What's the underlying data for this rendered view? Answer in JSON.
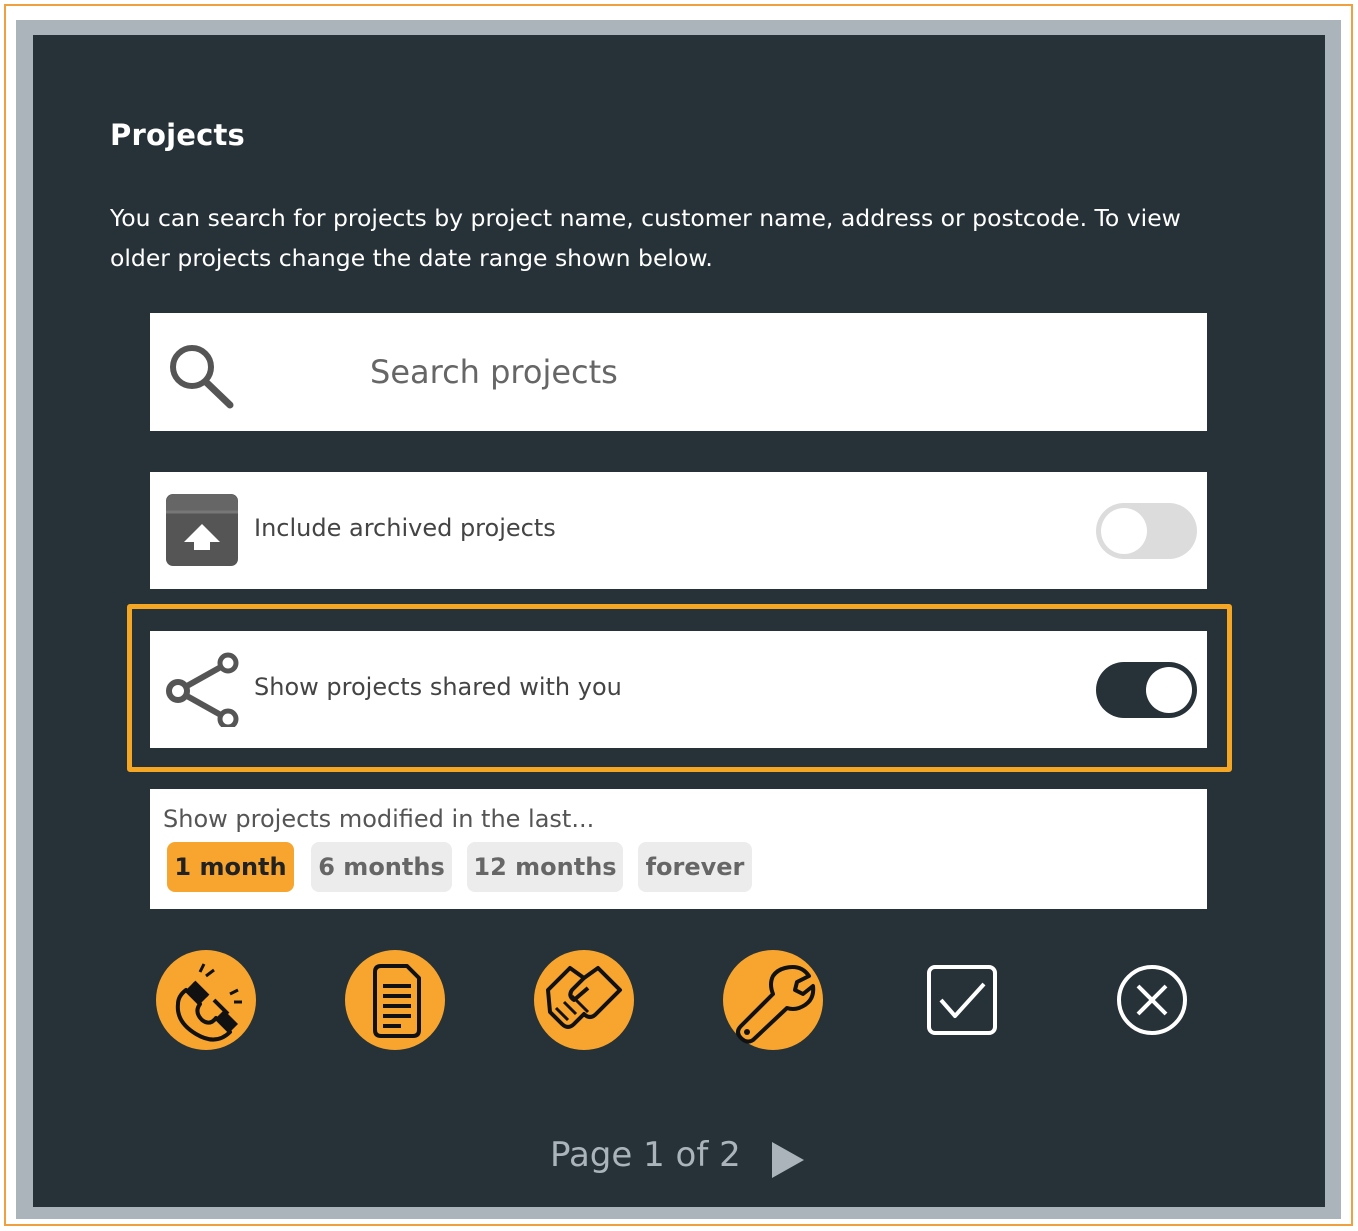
{
  "panel": {
    "title": "Projects",
    "description": "You can search for projects by project name, customer name, address or postcode. To view older projects change the date range shown below."
  },
  "search": {
    "placeholder": "Search projects",
    "value": "",
    "icon": "search-icon"
  },
  "options": {
    "archived": {
      "label": "Include archived projects",
      "icon": "archive-icon",
      "enabled": false
    },
    "shared": {
      "label": "Show projects shared with you",
      "icon": "share-icon",
      "enabled": true
    }
  },
  "date_range": {
    "label": "Show projects modified in the last...",
    "options": [
      "1 month",
      "6 months",
      "12 months",
      "forever"
    ],
    "selected": "1 month"
  },
  "actions": [
    {
      "icon": "magnet-icon"
    },
    {
      "icon": "document-icon"
    },
    {
      "icon": "handshake-icon"
    },
    {
      "icon": "wrench-icon"
    },
    {
      "icon": "checkbox-icon"
    },
    {
      "icon": "close-circle-icon"
    }
  ],
  "pagination": {
    "text": "Page 1 of 2"
  },
  "colors": {
    "accent": "#f7a52e",
    "highlight_border": "#f5a623",
    "panel_background": "#263238"
  }
}
